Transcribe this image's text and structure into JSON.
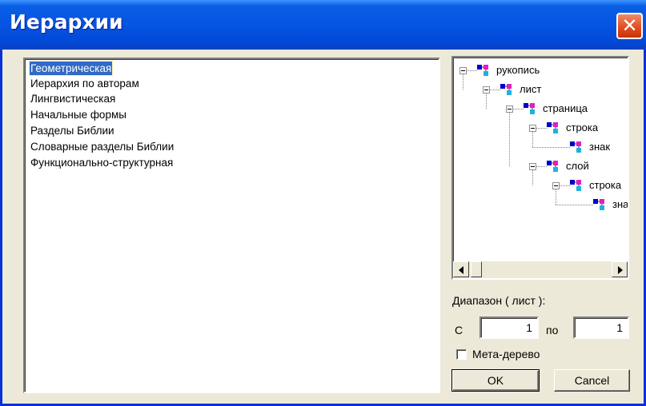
{
  "window": {
    "title": "Иерархии"
  },
  "hierarchies": {
    "selected_index": 0,
    "items": [
      "Геометрическая",
      "Иерархия по авторам",
      "Лингвистическая",
      "Начальные формы",
      "Разделы Библии",
      "Словарные разделы Библии",
      "Функционально-структурная"
    ]
  },
  "tree": {
    "nodes": [
      {
        "label": "рукопись",
        "level": 0,
        "expanded": true
      },
      {
        "label": "лист",
        "level": 1,
        "expanded": true
      },
      {
        "label": "страница",
        "level": 2,
        "expanded": true
      },
      {
        "label": "строка",
        "level": 3,
        "expanded": true
      },
      {
        "label": "знак",
        "level": 4
      },
      {
        "label": "слой",
        "level": 3,
        "expanded": true
      },
      {
        "label": "строка",
        "level": 4,
        "expanded": true
      },
      {
        "label": "зна",
        "level": 5
      }
    ]
  },
  "range": {
    "label": "Диапазон ( лист ):",
    "from_label": "С",
    "from_value": "1",
    "to_label": "по",
    "to_value": "1"
  },
  "meta_tree": {
    "label": "Мета-дерево",
    "checked": false
  },
  "buttons": {
    "ok": "OK",
    "cancel": "Cancel"
  },
  "icons": {
    "close": "close-icon",
    "node": "hierarchy-node-icon"
  },
  "colors": {
    "titlebar": "#0554e3",
    "selection": "#316ac5",
    "close": "#e04a1c"
  }
}
